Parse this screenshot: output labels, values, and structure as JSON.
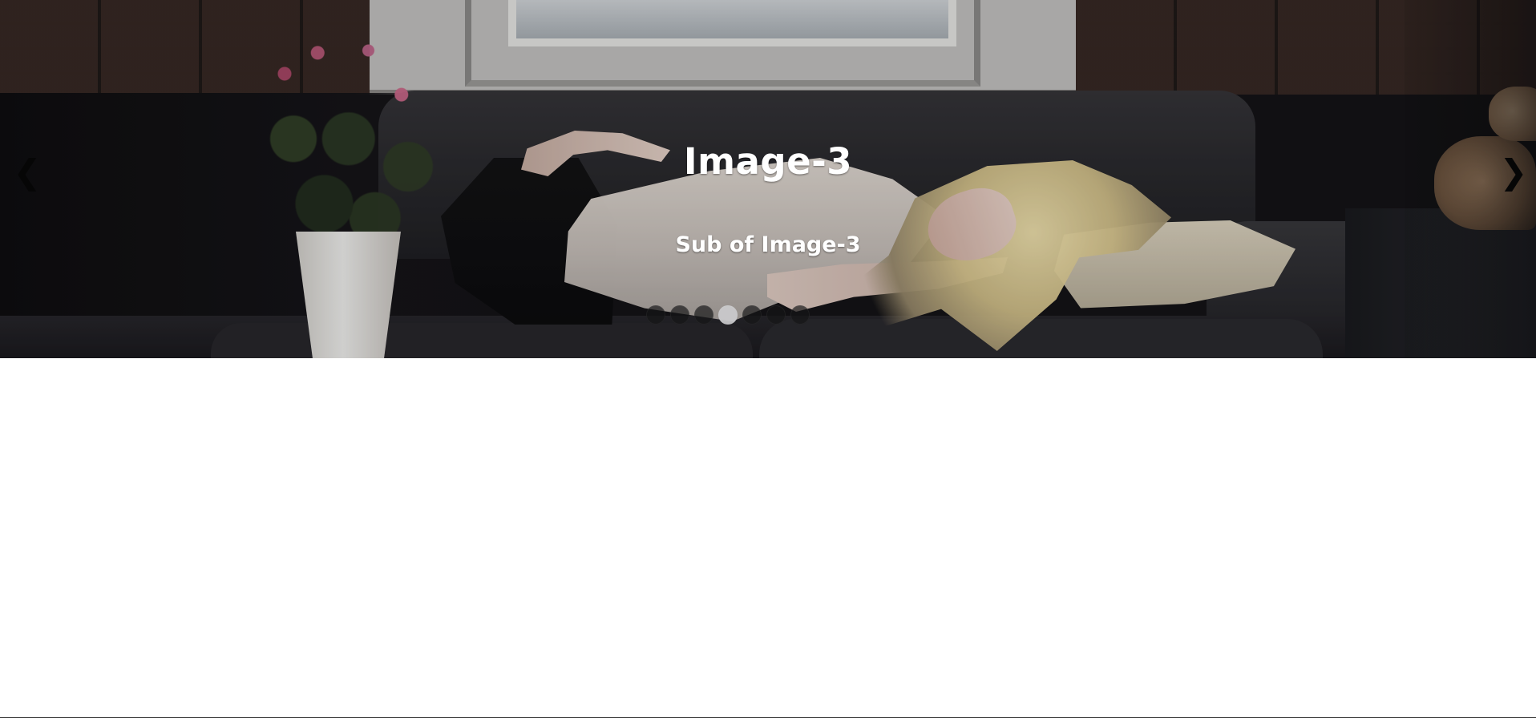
{
  "slider": {
    "slides": [
      {
        "title": "Image-3",
        "subtitle": "Sub of Image-3"
      }
    ],
    "active_index": 3,
    "dot_count": 7,
    "controls": {
      "prev_label": "❮",
      "next_label": "❯"
    }
  },
  "icons": {
    "prev": "chevron-left-icon",
    "next": "chevron-right-icon"
  },
  "colors": {
    "caption_text": "#ffffff",
    "nav_icon": "#060606",
    "dot_inactive": "#141416",
    "dot_active": "#cbcbcd"
  }
}
